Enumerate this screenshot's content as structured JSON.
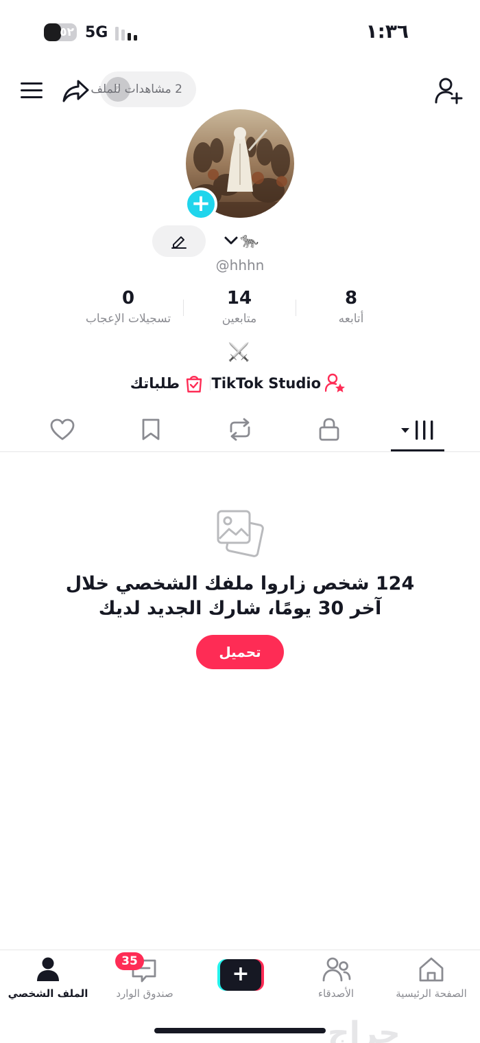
{
  "status_bar": {
    "time": "١:٣٦",
    "network": "5G",
    "battery": "٥٢",
    "battery_level": 0.52
  },
  "header": {
    "views_text": "2 مشاهدات للملف",
    "views_avatar": "2"
  },
  "profile": {
    "username": "@hhhn",
    "name_emoji": "🐆"
  },
  "stats": [
    {
      "value": "8",
      "label": "أتابعه"
    },
    {
      "value": "14",
      "label": "متابعين"
    },
    {
      "value": "0",
      "label": "تسجيلات الإعجاب"
    }
  ],
  "bio_emoji": "⚔️",
  "links": {
    "studio": "TikTok Studio",
    "orders": "طلباتك"
  },
  "empty_state": {
    "line1": "124 شخص زاروا ملفك الشخصي خلال",
    "line2": "آخر 30 يومًا، شارك الجديد لديك",
    "button": "تحميل"
  },
  "bottom_nav": {
    "home": "الصفحة الرئيسية",
    "friends": "الأصدقاء",
    "create": "+",
    "inbox": "صندوق الوارد",
    "inbox_badge": "35",
    "profile": "الملف الشخصي"
  },
  "watermark": "حراج",
  "colors": {
    "accent": "#fe2c55",
    "cyan": "#25f4ee",
    "badge_blue": "#20d5ec",
    "text": "#161823",
    "muted": "#8a8b91"
  }
}
